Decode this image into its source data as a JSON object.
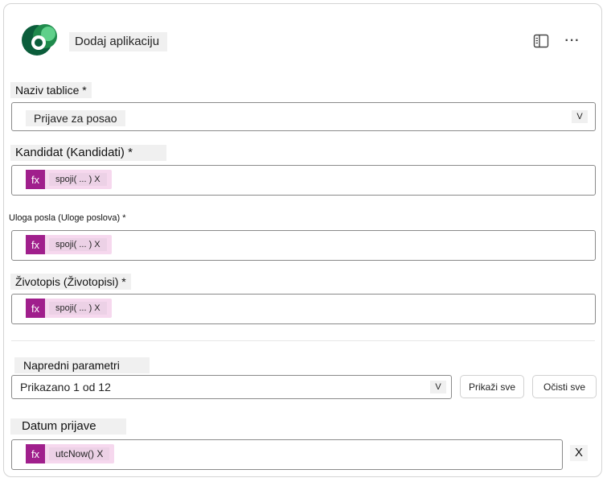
{
  "header": {
    "title": "Dodaj aplikaciju",
    "logo_icon": "dataverse-logo-icon",
    "sidebar_icon": "panel-icon",
    "more_icon": "ellipsis-icon",
    "more_label": "···"
  },
  "table_name": {
    "label": "Naziv tablice *",
    "value": "Prijave za posao",
    "chevron": "V"
  },
  "candidate": {
    "label": "Kandidat (Kandidati) *",
    "fx": "fx",
    "token": "spoji( ... ) X"
  },
  "job_role": {
    "label": "Uloga posla (Uloge poslova) *",
    "fx": "fx",
    "token": "spoji( ... ) X"
  },
  "resume": {
    "label": "Životopis (Životopisi) *",
    "fx": "fx",
    "token": "spoji( ... ) X"
  },
  "advanced": {
    "label": "Napredni parametri",
    "value": "Prikazano 1 od 12",
    "chevron": "V",
    "show_all": "Prikaži sve",
    "clear_all": "Očisti sve"
  },
  "apply_date": {
    "label": "Datum prijave",
    "fx": "fx",
    "token": "utcNow() X",
    "remove": "X"
  },
  "colors": {
    "fx_purple": "#a01f8c",
    "token_bg": "#f6d8ee",
    "logo_dark": "#0b5d3b",
    "logo_light": "#35b36b"
  }
}
